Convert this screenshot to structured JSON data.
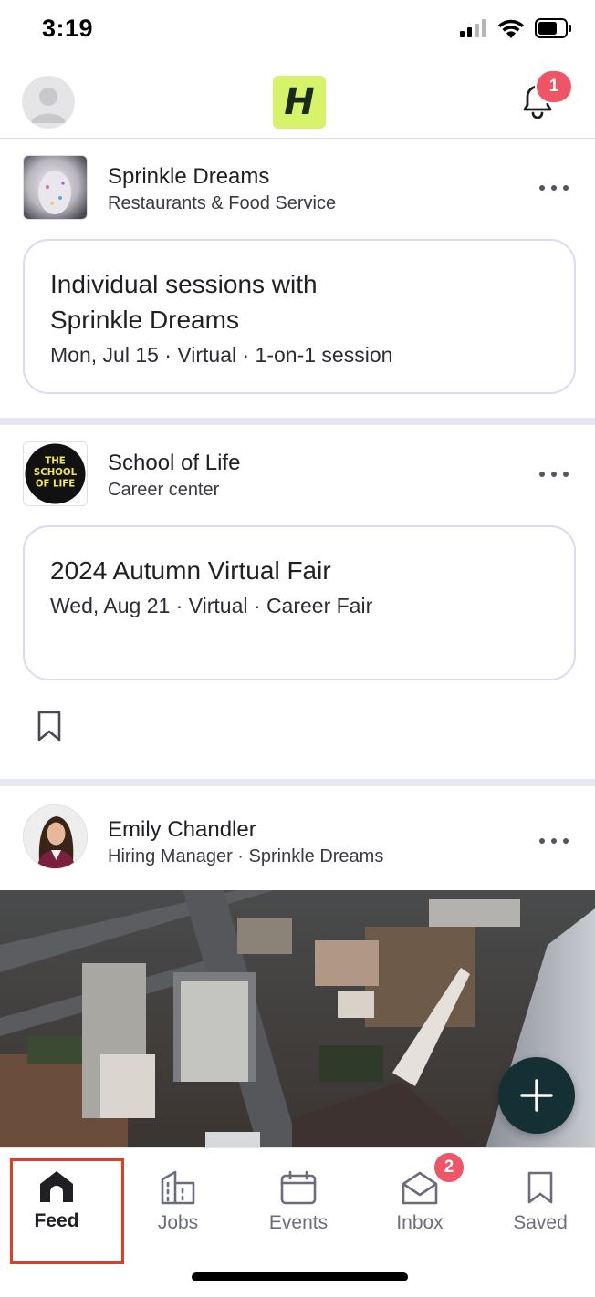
{
  "status": {
    "time": "3:19"
  },
  "header": {
    "logo": "H",
    "notification_count": "1"
  },
  "posts": [
    {
      "name": "Sprinkle Dreams",
      "subtitle": "Restaurants & Food Service",
      "event_title": "Individual sessions with Sprinkle Dreams",
      "event_meta": "Mon, Jul 15 · Virtual · 1-on-1 session"
    },
    {
      "name": "School of Life",
      "subtitle": "Career center",
      "logo_text": "THE SCHOOL OF LIFE",
      "event_title": "2024 Autumn Virtual Fair",
      "event_meta": "Wed, Aug 21 · Virtual · Career Fair"
    },
    {
      "name": "Emily Chandler",
      "subtitle": "Hiring Manager · Sprinkle Dreams"
    }
  ],
  "tabs": [
    {
      "label": "Feed",
      "icon": "home-icon",
      "active": true
    },
    {
      "label": "Jobs",
      "icon": "building-icon"
    },
    {
      "label": "Events",
      "icon": "calendar-icon"
    },
    {
      "label": "Inbox",
      "icon": "envelope-icon",
      "badge": "2"
    },
    {
      "label": "Saved",
      "icon": "bookmark-icon"
    }
  ],
  "colors": {
    "accent_logo": "#d7f36a",
    "fab": "#143035",
    "badge": "#ef5467",
    "highlight": "#e23d23"
  }
}
